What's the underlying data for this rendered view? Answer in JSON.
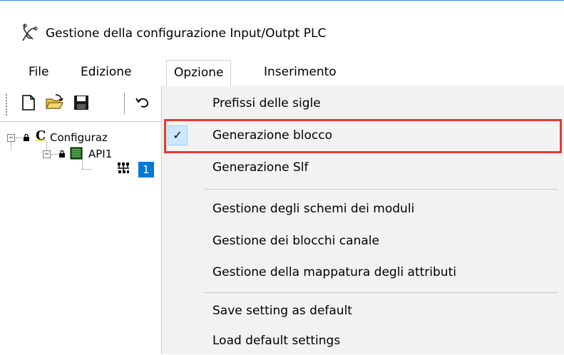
{
  "window": {
    "title": "Gestione  della configurazione Input/Outpt PLC",
    "icon": "app-tool-icon"
  },
  "menubar": {
    "items": [
      {
        "label": "File"
      },
      {
        "label": "Edizione"
      },
      {
        "label": "Opzione",
        "active": true
      },
      {
        "label": "Inserimento"
      }
    ]
  },
  "toolbar": {
    "buttons": [
      "new-file-icon",
      "open-folder-icon",
      "save-icon",
      "undo-icon"
    ]
  },
  "tree": {
    "root": {
      "prefix": "C",
      "label": "Configuraz"
    },
    "child": {
      "label": "API1"
    },
    "grandchild": {
      "label": "1"
    }
  },
  "dropdown": {
    "items": [
      {
        "label": "Prefissi delle sigle",
        "checked": false
      },
      {
        "label": "Generazione blocco",
        "checked": true
      },
      {
        "label": "Generazione Slf",
        "checked": false
      },
      {
        "label": "Gestione degli schemi dei moduli",
        "checked": false
      },
      {
        "label": "Gestione dei blocchi canale",
        "checked": false
      },
      {
        "label": "Gestione della mappatura degli attributi",
        "checked": false
      },
      {
        "label": "Save setting as default",
        "checked": false
      },
      {
        "label": "Load default settings",
        "checked": false
      }
    ],
    "check_glyph": "✓"
  },
  "colors": {
    "highlight": "#e53935",
    "check_bg": "#cce8ff",
    "selection": "#0078d7"
  }
}
